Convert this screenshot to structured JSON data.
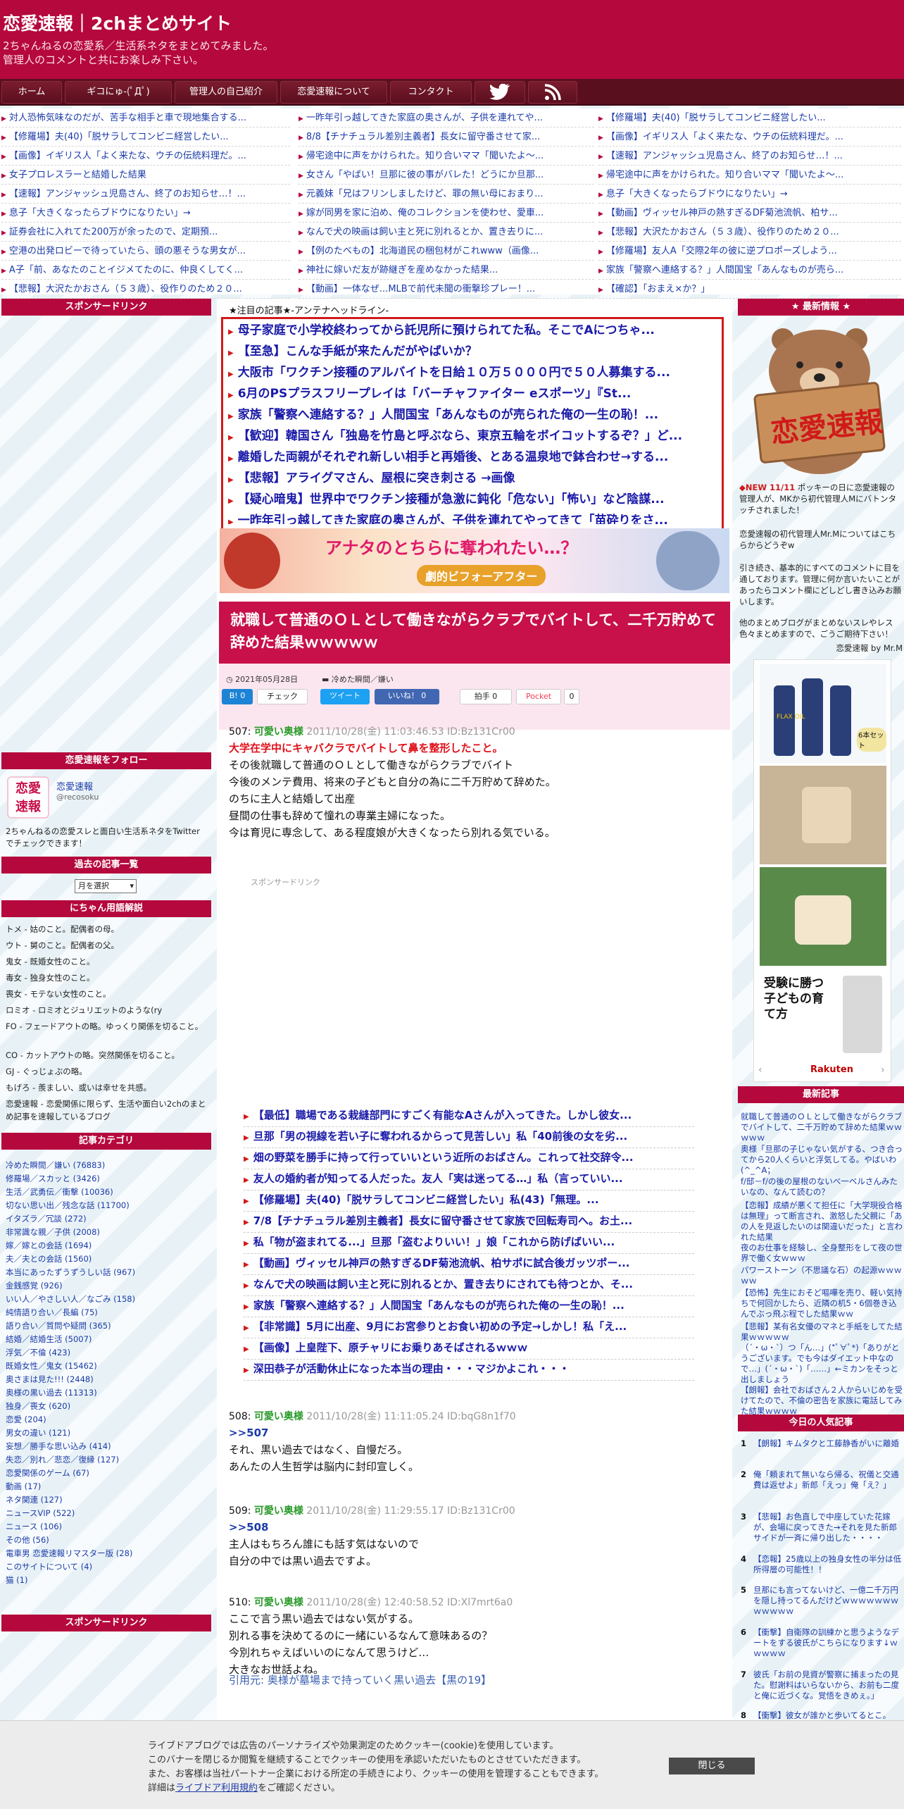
{
  "header": {
    "title": "恋愛速報｜2chまとめサイト",
    "tagline1": "2ちゃんねるの恋愛系／生活系ネタをまとめてみました。",
    "tagline2": "管理人のコメントと共にお楽しみ下さい。"
  },
  "nav": [
    "ホーム",
    "ギコにゅ-(ﾟДﾟ)",
    "管理人の自己紹介",
    "恋愛速報について",
    "コンタクト"
  ],
  "ticker": [
    [
      "対人恐怖気味なのだが、苦手な相手と車で現地集合する...",
      "一昨年引っ越してきた家庭の奥さんが、子供を連れてや...",
      "【修羅場】夫(40)「脱サラしてコンビニ経営したい..."
    ],
    [
      "【修羅場】夫(40)「脱サラしてコンビニ経営したい...",
      "8/8【チナチュラル差別主義者】長女に留守番させて家...",
      "【画像】イギリス人「よく来たな、ウチの伝統料理だ。..."
    ],
    [
      "【画像】イギリス人「よく来たな、ウチの伝統料理だ。...",
      "帰宅途中に声をかけられた。知り合いママ「聞いたよ～...",
      "【速報】アンジャッシュ児島さん、終了のお知らせ…！..."
    ],
    [
      "女子プロレスラーと結婚した結果",
      "女さん「やばい！旦那に彼の事がバレた！どうにか旦那...",
      "帰宅途中に声をかけられた。知り合いママ「聞いたよ～..."
    ],
    [
      "【速報】アンジャッシュ児島さん、終了のお知らせ…！...",
      "元義妹「兄はフリンしましたけど、罪の無い母におまり...",
      "息子「大きくなったらブドウになりたい」→"
    ],
    [
      "息子「大きくなったらブドウになりたい」→",
      "嫁が同男を家に泊め、俺のコレクションを使わせ、愛車...",
      "【動画】ヴィッセル神戸の熱すぎるDF菊池流帆、柏サ..."
    ],
    [
      "証券会社に入れてた200万が余ったので、定期預...",
      "なんで犬の映画は飼い主と死に別れるとか、置き去りに...",
      "【悲報】大沢たかおさん（５３歳）、役作りのため２０..."
    ],
    [
      "空港の出発ロビーで待っていたら、頭の悪そうな男女が...",
      "【例のたべもの】北海道民の梱包材がこれwww（画像...",
      "【修羅場】友人A「交際2年の彼に逆プロポーズしよう..."
    ],
    [
      "A子「前、あなたのことイジメてたのに、仲良くしてく...",
      "神社に嫁いだ友が跡継ぎを産めなかった結果...",
      "家族「警察へ連絡する？」人間国宝「あんなものが売ら..."
    ],
    [
      "【悲報】大沢たかおさん（５３歳）、役作りのため２０...",
      "【動画】一体なぜ...MLBで前代未聞の衝撃珍プレー！...",
      "【確認】「おまえ×か？」"
    ]
  ],
  "left": {
    "sponsor": "スポンサードリンク",
    "follow": "恋愛速報をフォロー",
    "account_name": "恋愛速報",
    "account_handle": "@recosoku",
    "follow_desc": "2ちゃんねるの恋愛スレと面白い生活系ネタをTwitterでチェックできます！",
    "archive": "過去の記事一覧",
    "archive_select": "月を選択",
    "glossary_title": "にちゃん用語解説",
    "glossary": [
      "トメ - 姑のこと。配偶者の母。",
      "ウト - 舅のこと。配偶者の父。",
      "鬼女 - 既婚女性のこと。",
      "毒女 - 独身女性のこと。",
      "喪女 - モテない女性のこと。",
      "ロミオ - ロミオとジュリエットのような(ry",
      "FO - フェードアウトの略。ゆっくり関係を切ること。",
      "CO - カットアウトの略。突然関係を切ること。",
      "GJ - ぐっじょぶの略。",
      "もげろ - 羨ましい、或いは幸せを共感。",
      "恋愛速報 - 恋愛関係に限らず、生活や面白い2chのまとめ記事を速報しているブログ"
    ],
    "category_title": "記事カテゴリ",
    "categories": [
      "冷めた瞬間／嫌い (76883)",
      "修羅場／スカッと (3426)",
      "生活／武勇伝／衝撃 (10036)",
      "切ない思い出／残念な話 (11700)",
      "イタズラ／冗談 (272)",
      "非常識な親／子供 (2008)",
      "嫁／嫁との会話 (1694)",
      "夫／夫との会話 (1560)",
      "本当にあったずうずうしい話 (967)",
      "金銭感覚 (926)",
      "いい人／やさしい人／なごみ (158)",
      "純情語り合い／長編 (75)",
      "語り合い／質問や疑問 (365)",
      "結婚／結婚生活 (5007)",
      "浮気／不倫 (423)",
      "既婚女性／鬼女 (15462)",
      "奥さまは見た!!! (2448)",
      "奥様の黒い過去 (11313)",
      "独身／喪女 (620)",
      "恋愛 (204)",
      "男女の違い (121)",
      "妄想／勝手な思い込み (414)",
      "失恋／別れ／悲恋／復縁 (127)",
      "恋愛関係のゲーム (67)",
      "動画 (17)",
      "ネタ関連 (127)",
      "ニュースVIP (522)",
      "ニュース (106)",
      "その他 (56)",
      "電車男 恋愛速報リマスター版 (28)",
      "このサイトについて (4)",
      "猫 (1)"
    ],
    "sponsor2": "スポンサードリンク"
  },
  "antenna": {
    "title": "★注目の記事★-アンテナヘッドライン-",
    "items": [
      "母子家庭で小学校終わってから託児所に預けられてた私。そこでAにつちゃ...",
      "【至急】こんな手紙が来たんだがやばいか？",
      "大阪市「ワクチン接種のアルバイトを日給１０万５０００円で５０人募集する...",
      "6月のPSプラスフリープレイは「バーチャファイター eスポーツ」『St...",
      "家族「警察へ連絡する？」人間国宝「あんなものが売られた俺の一生の恥！...",
      "【歓迎】韓国さん「独島を竹島と呼ぶなら、東京五輪をボイコットするぞ？」ど...",
      "離婚した両親がそれぞれ新しい相手と再婚後、とある温泉地で鉢合わせ→する...",
      "【悲報】アライグマさん、屋根に突き刺さる →画像",
      "【疑心暗鬼】世界中でワクチン接種が急激に鈍化「危ない」「怖い」など陰謀...",
      "一昨年引っ越してきた家庭の奥さんが、子供を連れてやってきて「苗砕りをさ..."
    ]
  },
  "banner": {
    "text1": "アナタのとちらに奪われたい…？",
    "text2": "劇的ビフォーアフター"
  },
  "article": {
    "title": "就職して普通のＯＬとして働きながらクラブでバイトして、二千万貯めて辞めた結果ｗｗｗｗｗ",
    "date": "2021年05月28日",
    "category": "冷めた瞬間／嫌い",
    "shares": [
      "B! 0",
      "チェック",
      "ツイート",
      "いいね！ 0",
      "拍手 0",
      "Pocket",
      "0"
    ],
    "sponsor": "スポンサードリンク",
    "posts": [
      {
        "head": "507: ",
        "name": "可愛い奥様",
        "meta": " 2011/10/28(金) 11:03:46.53 ID:Bz131Cr00",
        "red": "大学在学中にキャバクラでバイトして鼻を整形したこと。",
        "body": "その後就職して普通のＯＬとして働きながらクラブでバイト\n今後のメンテ費用、将来の子どもと自分の為に二千万貯めて辞めた。\nのちに主人と結婚して出産\n昼間の仕事も辞めて憧れの専業主婦になった。\n今は育児に専念して、ある程度娘が大きくなったら別れる気でいる。"
      },
      {
        "head": "508: ",
        "name": "可愛い奥様",
        "meta": " 2011/10/28(金) 11:11:05.24 ID:bqG8n1f70",
        "ref": ">>507",
        "body": "それ、黒い過去ではなく、自慢だろ。\nあんたの人生哲学は脳内に封印宣しく。"
      },
      {
        "head": "509: ",
        "name": "可愛い奥様",
        "meta": " 2011/10/28(金) 11:29:55.17 ID:Bz131Cr00",
        "ref": ">>508",
        "body": "主人はもちろん誰にも話す気はないので\n自分の中では黒い過去ですよ。"
      },
      {
        "head": "510: ",
        "name": "可愛い奥様",
        "meta": " 2011/10/28(金) 12:40:58.52 ID:Xl7mrt6a0",
        "body": "ここで言う黒い過去ではない気がする。\n別れる事を決めてるのに一緒にいるなんて意味あるの？\n今別れちゃえばいいのになんて思うけど…\n大きなお世話よね。"
      }
    ],
    "quote": "引用元: 奥様が墓場まで持っていく黒い過去【黒の19】"
  },
  "related": [
    "【最低】職場である栽縫部門にすごく有能なAさんが入ってきた。しかし彼女...",
    "旦那「男の視線を若い子に奪われるからって見苦しい」私「40前後の女を劣...",
    "畑の野菜を勝手に持って行っていいという近所のおばさん。これって社交辞令...",
    "友人の婚約者が知ってる人だった。友人「実は迷ってる…」私（言っていい...",
    "【修羅場】夫(40)「脱サラしてコンビニ経営したい」私(43)「無理。...",
    "7/8【チナチュラル差別主義者】長女に留守番させて家族で回転寿司へ。お土...",
    "私「物が盗まれてる...」旦那「盗むよりいい！」娘「これから防げばいい...",
    "【動画】ヴィッセル神戸の熱すぎるDF菊池流帆、柏サポに試合後ガッツポー...",
    "なんで犬の映画は飼い主と死に別れるとか、置き去りにされても待つとか、そ...",
    "家族「警察へ連絡する？」人間国宝「あんなものが売られた俺の一生の恥！...",
    "【非常識】5月に出産、9月にお宮参りとお食い初めの予定→しかし！私「え...",
    "【画像】上皇陛下、原チャリにお乗りあそばされるｗｗｗ",
    "深田恭子が活動休止になった本当の理由・・・マジかよこれ・・・"
  ],
  "right": {
    "new_title": "★ 最新情報 ★",
    "logo": "恋愛速報",
    "notice_new": "NEW 11/11",
    "notice_text": "ポッキーの日に恋愛速報の管理人が、MKから初代管理人Mにバトンタッチされました！",
    "intro1": "恋愛速報の初代管理人Mr.Mについてはこちらからどうぞw",
    "intro2": "引き続き、基本的にすべてのコメントに目を通しております。管理に何か言いたいことがあったらコメント欄にどしどし書き込みお願いします。",
    "intro3": "他のまとめブログがまとめないスレやレス色々まとめますので、ごうご期待下さい！",
    "intro4": "恋愛速報 by Mr.M",
    "ad_labels": [
      "FLAX OIL",
      "6本セット"
    ],
    "book": "受験に勝つ子どもの育て方",
    "rakuten": "Rakuten",
    "latest_title": "最新記事",
    "latest": [
      "就職して普通のＯＬとして働きながらクラブでバイトして、二千万貯めて辞めた結果ｗｗｗｗｗ",
      "奥様「旦那の子じゃない気がする、つき合ってから20人くらいと浮気してる。やばいわ(^_^A；",
      "f/邸－f/の後の屋根のないべ一ベルさんみたいなの、なんて読むの？",
      "【恋報】成績が悪くて担任に「大学現役合格は無理」って断言され、激怒した父親に「あの人を見返したいのは関違いだった」と言われた結果",
      "夜のお仕事を経験し、全身整形をして夜の世界で働く女ｗｗｗ",
      "パワーストーン（不思議な石）の起源ｗｗｗｗｗ",
      "【恐怖】先生におそど嘔嘩を売り、軽い気持ちで何回かしたら、近隣の机5・6個巻き込んでぶっ飛ぶ程でした結果ｗｗ",
      "【悲報】某有名女優のマネと手紙をしてた結果ｗｗｗｗｗ",
      "（´・ω・`）つ「ん…」(*ﾟ∀ﾟ*)「ありがとうございます。でも今はダイエット中なので…」(´・ω・`)「……」←ミカンをそっと出しましょう",
      "【朗報】会社でおばさん２人からいじめを受けてたので、不倫の密告を家族に電話してみた結果ｗｗｗｗ"
    ],
    "popular_title": "今日の人気記事",
    "popular": [
      "【朗報】キムタクと工藤静香がいに離婚",
      "俺「頼まれて無いなら帰る、祝儀と交通費は返せよ」新郎「えっ」俺「え？」",
      "【悲報】お色直しで中座していた花嫁が、会場に戻ってきた→それを見た新郎サイドが一斉に帰り出した・・・・",
      "【恋報】25歳以上の独身女性の半分は低所得層の可能性！！",
      "旦那にも言ってないけど、一億二千万円を隠し持ってるんだけどｗｗｗｗｗｗｗｗｗｗｗｗ",
      "【衝撃】自衛隊の訓練かと思うようなデートをする彼氏がこちらになります↓ｗｗｗｗｗ",
      "彼氏「お前の見資が警察に捕まったの見た。慰謝料はいらないから、お前も二度と俺に近づくな。覚悟をきめぇ。」",
      "【衝撃】彼女が誰かと歩いてるとこ。"
    ]
  },
  "cookie": {
    "l1": "ライブドアブログでは広告のパーソナライズや効果測定のためクッキー(cookie)を使用しています。",
    "l2": "このバナーを閉じるか閲覧を継続することでクッキーの使用を承認いただいたものとさせていただきます。",
    "l3": "また、お客様は当社パートナー企業における所定の手続きにより、クッキーの使用を管理することもできます。",
    "l4a": "詳細は",
    "l4link": "ライブドア利用規約",
    "l4b": "をご確認ください。",
    "close": "閉じる"
  }
}
